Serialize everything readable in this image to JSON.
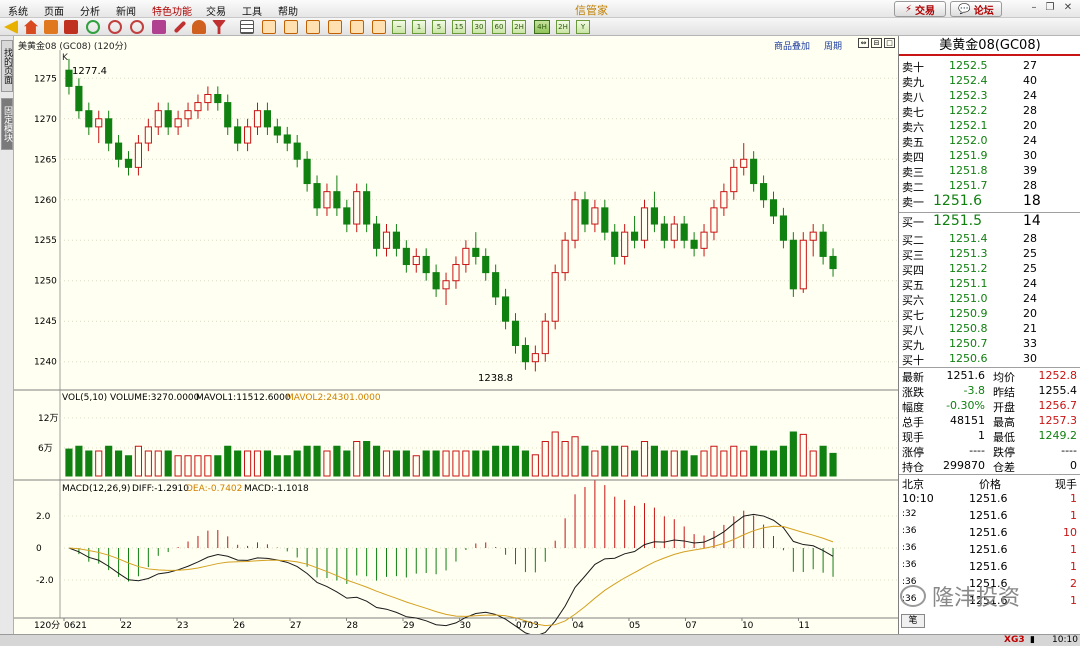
{
  "menu": {
    "items": [
      "系统",
      "页面",
      "分析",
      "新闻",
      "特色功能",
      "交易",
      "工具",
      "帮助"
    ],
    "active_index": 4,
    "app_title": "信管家",
    "trade_button": "交易",
    "forum_button": "论坛"
  },
  "toolbar": {
    "periods": [
      "1",
      "5",
      "15",
      "30",
      "60",
      "2H",
      "4H",
      "Y"
    ],
    "selected_period": "2H"
  },
  "left_tabs": [
    "找的页面",
    "固定模块"
  ],
  "chart": {
    "header_label": "美黄金08 (GC08) (120分)",
    "link_overlay": "商品叠加",
    "link_period": "周期",
    "k_label": "K",
    "max_label": "1277.4",
    "min_label": "1238.8",
    "price_ticks": [
      "1275",
      "1270",
      "1265",
      "1260",
      "1255",
      "1250",
      "1245",
      "1240"
    ],
    "vol_label": "VOL(5,10)",
    "vol_value": "VOLUME:3270.0000",
    "mavol1": "MAVOL1:11512.6000",
    "mavol2": "MAVOL2:24301.0000",
    "vol_ticks": [
      "12万",
      "6万"
    ],
    "macd_label": "MACD(12,26,9)",
    "diff": "DIFF:-1.2910",
    "dea": "DEA:-0.7402",
    "macd": "MACD:-1.1018",
    "macd_ticks": [
      "2.0",
      "0",
      "-2.0"
    ],
    "period_label": "120分",
    "date_labels": [
      "0621",
      "22",
      "23",
      "26",
      "27",
      "28",
      "29",
      "30",
      "0703",
      "04",
      "05",
      "07",
      "10",
      "11"
    ],
    "colors": {
      "up": "#c81414",
      "down": "#108010",
      "diff": "#1a1a1a",
      "dea": "#d4a020"
    }
  },
  "chart_data": {
    "type": "candlestick",
    "title": "美黄金08 (GC08) (120分)",
    "ylim": [
      1237,
      1278
    ],
    "max": 1277.4,
    "min": 1238.8,
    "candles": [
      [
        1276,
        1277.4,
        1273,
        1274
      ],
      [
        1274,
        1275,
        1270,
        1271
      ],
      [
        1271,
        1272,
        1268,
        1269
      ],
      [
        1269,
        1271,
        1267,
        1270
      ],
      [
        1270,
        1271,
        1266,
        1267
      ],
      [
        1267,
        1268,
        1264,
        1265
      ],
      [
        1265,
        1266,
        1263,
        1264
      ],
      [
        1264,
        1268,
        1263,
        1267
      ],
      [
        1267,
        1270,
        1266,
        1269
      ],
      [
        1269,
        1272,
        1268,
        1271
      ],
      [
        1271,
        1272,
        1268,
        1269
      ],
      [
        1269,
        1271,
        1268,
        1270
      ],
      [
        1270,
        1272,
        1269,
        1271
      ],
      [
        1271,
        1273,
        1270,
        1272
      ],
      [
        1272,
        1274,
        1271,
        1273
      ],
      [
        1273,
        1274,
        1271,
        1272
      ],
      [
        1272,
        1273,
        1268,
        1269
      ],
      [
        1269,
        1270,
        1266,
        1267
      ],
      [
        1267,
        1270,
        1266,
        1269
      ],
      [
        1269,
        1272,
        1268,
        1271
      ],
      [
        1271,
        1272,
        1268,
        1269
      ],
      [
        1269,
        1270,
        1267,
        1268
      ],
      [
        1268,
        1269,
        1266,
        1267
      ],
      [
        1267,
        1268,
        1264,
        1265
      ],
      [
        1265,
        1266,
        1261,
        1262
      ],
      [
        1262,
        1263,
        1258,
        1259
      ],
      [
        1259,
        1262,
        1258,
        1261
      ],
      [
        1261,
        1263,
        1258,
        1259
      ],
      [
        1259,
        1260,
        1256,
        1257
      ],
      [
        1257,
        1262,
        1256,
        1261
      ],
      [
        1261,
        1262,
        1256,
        1257
      ],
      [
        1257,
        1258,
        1253,
        1254
      ],
      [
        1254,
        1257,
        1253,
        1256
      ],
      [
        1256,
        1257,
        1253,
        1254
      ],
      [
        1254,
        1255,
        1251,
        1252
      ],
      [
        1252,
        1254,
        1251,
        1253
      ],
      [
        1253,
        1254,
        1250,
        1251
      ],
      [
        1251,
        1252,
        1248,
        1249
      ],
      [
        1249,
        1251,
        1247,
        1250
      ],
      [
        1250,
        1253,
        1249,
        1252
      ],
      [
        1252,
        1255,
        1251,
        1254
      ],
      [
        1254,
        1256,
        1252,
        1253
      ],
      [
        1253,
        1254,
        1250,
        1251
      ],
      [
        1251,
        1252,
        1247,
        1248
      ],
      [
        1248,
        1249,
        1244,
        1245
      ],
      [
        1245,
        1246,
        1241,
        1242
      ],
      [
        1242,
        1243,
        1239,
        1240
      ],
      [
        1240,
        1242,
        1238.8,
        1241
      ],
      [
        1241,
        1246,
        1240,
        1245
      ],
      [
        1245,
        1252,
        1244,
        1251
      ],
      [
        1251,
        1256,
        1250,
        1255
      ],
      [
        1255,
        1261,
        1254,
        1260
      ],
      [
        1260,
        1261,
        1256,
        1257
      ],
      [
        1257,
        1260,
        1256,
        1259
      ],
      [
        1259,
        1260,
        1255,
        1256
      ],
      [
        1256,
        1257,
        1252,
        1253
      ],
      [
        1253,
        1257,
        1252,
        1256
      ],
      [
        1256,
        1258,
        1254,
        1255
      ],
      [
        1255,
        1260,
        1254,
        1259
      ],
      [
        1259,
        1261,
        1256,
        1257
      ],
      [
        1257,
        1258,
        1254,
        1255
      ],
      [
        1255,
        1258,
        1254,
        1257
      ],
      [
        1257,
        1258,
        1254,
        1255
      ],
      [
        1255,
        1256,
        1253,
        1254
      ],
      [
        1254,
        1257,
        1253,
        1256
      ],
      [
        1256,
        1260,
        1255,
        1259
      ],
      [
        1259,
        1262,
        1258,
        1261
      ],
      [
        1261,
        1265,
        1260,
        1264
      ],
      [
        1264,
        1267,
        1263,
        1265
      ],
      [
        1265,
        1266,
        1261,
        1262
      ],
      [
        1262,
        1263,
        1259,
        1260
      ],
      [
        1260,
        1261,
        1257,
        1258
      ],
      [
        1258,
        1259,
        1254,
        1255
      ],
      [
        1255,
        1256,
        1248,
        1249
      ],
      [
        1249,
        1256,
        1248.5,
        1255
      ],
      [
        1255,
        1257,
        1253,
        1256
      ],
      [
        1256,
        1257,
        1252,
        1253
      ],
      [
        1253,
        1254,
        1250.5,
        1251.5
      ]
    ]
  },
  "panel": {
    "title": "美黄金08(GC08)",
    "asks": [
      {
        "label": "卖十",
        "price": "1252.5",
        "vol": "27"
      },
      {
        "label": "卖九",
        "price": "1252.4",
        "vol": "40"
      },
      {
        "label": "卖八",
        "price": "1252.3",
        "vol": "24"
      },
      {
        "label": "卖七",
        "price": "1252.2",
        "vol": "28"
      },
      {
        "label": "卖六",
        "price": "1252.1",
        "vol": "20"
      },
      {
        "label": "卖五",
        "price": "1252.0",
        "vol": "24"
      },
      {
        "label": "卖四",
        "price": "1251.9",
        "vol": "30"
      },
      {
        "label": "卖三",
        "price": "1251.8",
        "vol": "39"
      },
      {
        "label": "卖二",
        "price": "1251.7",
        "vol": "28"
      }
    ],
    "ask1": {
      "label": "卖一",
      "price": "1251.6",
      "vol": "18"
    },
    "bid1": {
      "label": "买一",
      "price": "1251.5",
      "vol": "14"
    },
    "bids": [
      {
        "label": "买二",
        "price": "1251.4",
        "vol": "28"
      },
      {
        "label": "买三",
        "price": "1251.3",
        "vol": "25"
      },
      {
        "label": "买四",
        "price": "1251.2",
        "vol": "25"
      },
      {
        "label": "买五",
        "price": "1251.1",
        "vol": "24"
      },
      {
        "label": "买六",
        "price": "1251.0",
        "vol": "24"
      },
      {
        "label": "买七",
        "price": "1250.9",
        "vol": "20"
      },
      {
        "label": "买八",
        "price": "1250.8",
        "vol": "21"
      },
      {
        "label": "买九",
        "price": "1250.7",
        "vol": "33"
      },
      {
        "label": "买十",
        "price": "1250.6",
        "vol": "30"
      }
    ],
    "stats": [
      {
        "l1": "最新",
        "v1": "1251.6",
        "l2": "均价",
        "v2": "1252.8"
      },
      {
        "l1": "涨跌",
        "v1": "-3.8",
        "l2": "昨结",
        "v2": "1255.4"
      },
      {
        "l1": "幅度",
        "v1": "-0.30%",
        "l2": "开盘",
        "v2": "1256.7"
      },
      {
        "l1": "总手",
        "v1": "48151",
        "l2": "最高",
        "v2": "1257.3"
      },
      {
        "l1": "现手",
        "v1": "1",
        "l2": "最低",
        "v2": "1249.2"
      },
      {
        "l1": "涨停",
        "v1": "----",
        "l2": "跌停",
        "v2": "----"
      },
      {
        "l1": "持仓",
        "v1": "299870",
        "l2": "仓差",
        "v2": "0"
      }
    ],
    "ticks_header": {
      "time": "北京",
      "price": "价格",
      "vol": "现手"
    },
    "ticks": [
      {
        "time": "10:10",
        "price": "1251.6",
        "vol": "1"
      },
      {
        "time": ":32",
        "price": "1251.6",
        "vol": "1"
      },
      {
        "time": ":36",
        "price": "1251.6",
        "vol": "10"
      },
      {
        "time": ":36",
        "price": "1251.6",
        "vol": "1"
      },
      {
        "time": ":36",
        "price": "1251.6",
        "vol": "1"
      },
      {
        "time": ":36",
        "price": "1251.6",
        "vol": "2"
      },
      {
        "time": ":36",
        "price": "1251.6",
        "vol": "1"
      }
    ],
    "bottom_tab": "笔"
  },
  "watermark": "隆沣投资",
  "status": {
    "xg": "XG3",
    "clock": "10:10"
  }
}
